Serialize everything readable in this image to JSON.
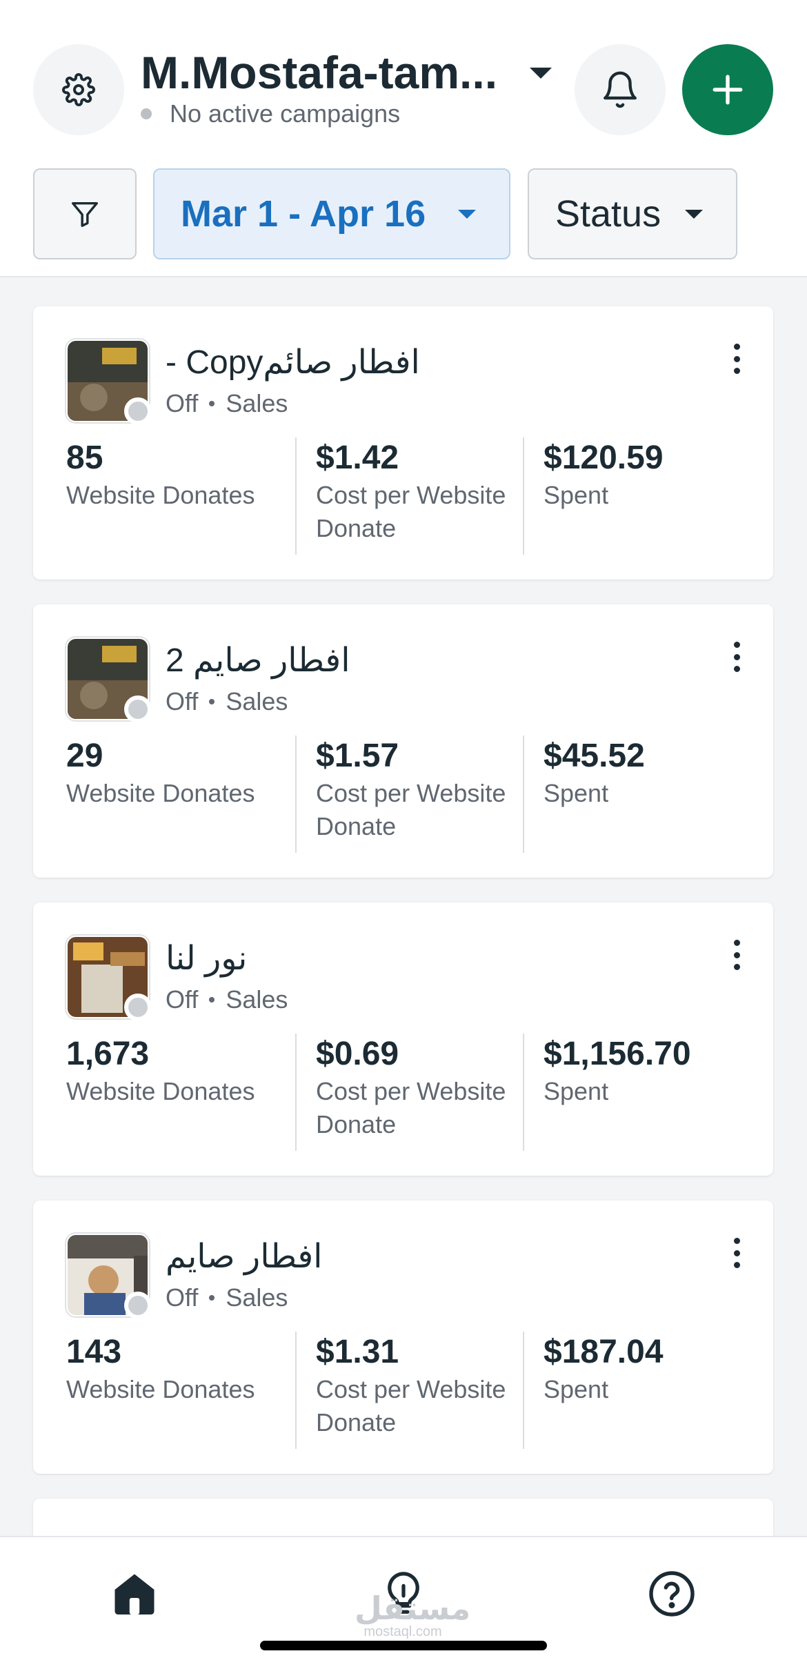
{
  "header": {
    "account_name": "M.Mostafa-tam...",
    "status_text": "No active campaigns",
    "date_range": "Mar 1 - Apr 16",
    "status_filter": "Status",
    "icons": {
      "settings": "gear-icon",
      "bell": "bell-icon",
      "create": "plus-icon",
      "filter": "funnel-icon"
    },
    "colors": {
      "create_button": "#0a7c52",
      "date_text": "#1a6fbf",
      "date_background": "#e7f0fa"
    }
  },
  "campaigns": [
    {
      "name": "افطار صائمCopy -",
      "status": "Off",
      "objective": "Sales",
      "results_value": "85",
      "results_label": "Website Donates",
      "cost_value": "$1.42",
      "cost_label": "Cost per Website Donate",
      "spent_value": "$120.59",
      "spent_label": "Spent"
    },
    {
      "name": "افطار صايم 2",
      "status": "Off",
      "objective": "Sales",
      "results_value": "29",
      "results_label": "Website Donates",
      "cost_value": "$1.57",
      "cost_label": "Cost per Website Donate",
      "spent_value": "$45.52",
      "spent_label": "Spent"
    },
    {
      "name": "نور لنا",
      "status": "Off",
      "objective": "Sales",
      "results_value": "1,673",
      "results_label": "Website Donates",
      "cost_value": "$0.69",
      "cost_label": "Cost per Website Donate",
      "spent_value": "$1,156.70",
      "spent_label": "Spent"
    },
    {
      "name": "افطار صايم",
      "status": "Off",
      "objective": "Sales",
      "results_value": "143",
      "results_label": "Website Donates",
      "cost_value": "$1.31",
      "cost_label": "Cost per Website Donate",
      "spent_value": "$187.04",
      "spent_label": "Spent"
    }
  ],
  "bottom_nav": {
    "items": [
      "home-icon",
      "lightbulb-icon",
      "help-icon"
    ],
    "watermark_ar": "مستقل",
    "watermark_en": "mostaql.com"
  }
}
